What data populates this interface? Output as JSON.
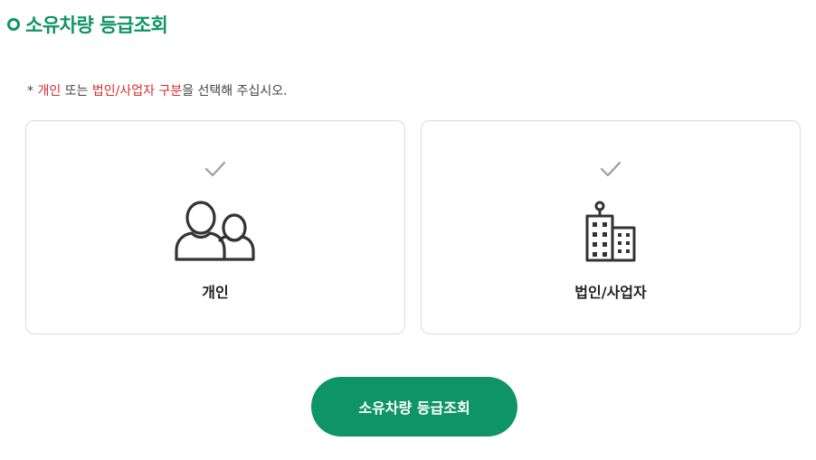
{
  "page": {
    "title": "소유차량 등급조회"
  },
  "notice": {
    "prefix": "* ",
    "highlight1": "개인",
    "mid": " 또는 ",
    "highlight2": "법인/사업자 구분",
    "suffix": "을 선택해 주십시오."
  },
  "options": {
    "personal": {
      "label": "개인",
      "icon": "people-icon",
      "check_icon": "check-icon"
    },
    "business": {
      "label": "법인/사업자",
      "icon": "building-icon",
      "check_icon": "check-icon"
    }
  },
  "actions": {
    "submit_label": "소유차량 등급조회"
  },
  "colors": {
    "brand": "#0f9468",
    "highlight": "#d32f2f",
    "card_border": "#dcdcdc",
    "check_gray": "#9e9e9e"
  }
}
